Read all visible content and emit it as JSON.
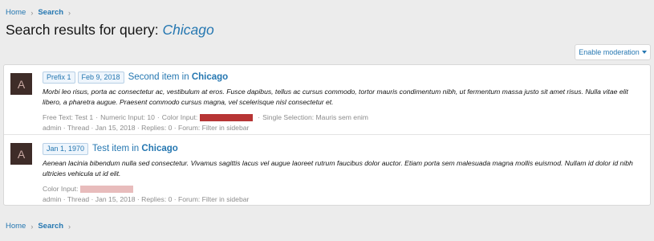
{
  "breadcrumb": {
    "home": "Home",
    "search": "Search",
    "sep": "›"
  },
  "title": {
    "prefix": "Search results for query:",
    "query": "Chicago"
  },
  "moderation_button": "Enable moderation",
  "results": [
    {
      "avatar_letter": "A",
      "labels": [
        "Prefix 1",
        "Feb 9, 2018"
      ],
      "title": "Second item in",
      "title_highlight": "Chicago",
      "snippet": "Morbi leo risus, porta ac consectetur ac, vestibulum at eros. Fusce dapibus, tellus ac cursus commodo, tortor mauris condimentum nibh, ut fermentum massa justo sit amet risus. Nulla vitae elit libero, a pharetra augue. Praesent commodo cursus magna, vel scelerisque nisl consectetur et.",
      "fields": {
        "free_text": "Free Text: Test 1",
        "numeric": "Numeric Input: 10",
        "color_label": "Color Input:",
        "color_value": "#b73535",
        "single": "Single Selection: Mauris sem enim"
      },
      "meta": {
        "author": "admin",
        "type": "Thread",
        "date": "Jan 15, 2018",
        "replies": "Replies: 0",
        "forum": "Forum: Filter in sidebar"
      }
    },
    {
      "avatar_letter": "A",
      "labels": [
        "Jan 1, 1970"
      ],
      "title": "Test item in",
      "title_highlight": "Chicago",
      "snippet": "Aenean lacinia bibendum nulla sed consectetur. Vivamus sagittis lacus vel augue laoreet rutrum faucibus dolor auctor. Etiam porta sem malesuada magna mollis euismod. Nullam id dolor id nibh ultricies vehicula ut id elit.",
      "fields": {
        "color_label": "Color Input:",
        "color_value": "#e8bcbc"
      },
      "meta": {
        "author": "admin",
        "type": "Thread",
        "date": "Jan 15, 2018",
        "replies": "Replies: 0",
        "forum": "Forum: Filter in sidebar"
      }
    }
  ],
  "meta_sep": "·",
  "field_sep": "·"
}
